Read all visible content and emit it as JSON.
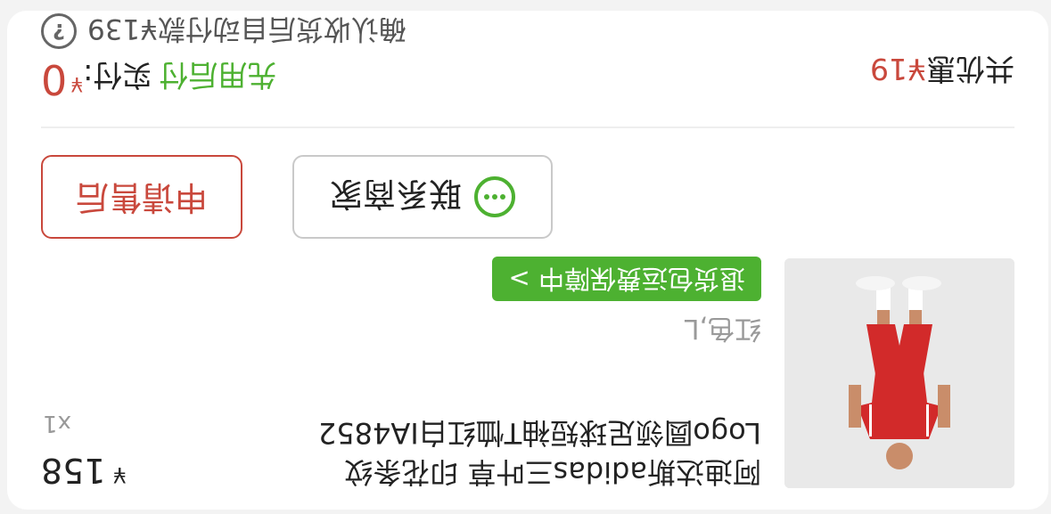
{
  "product": {
    "title": "阿迪达斯adidas三叶草 印花条纹Logo圆领足球短袖T恤红白IA4852",
    "price_symbol": "¥",
    "price": "158",
    "quantity": "x1",
    "variant": "红色,L",
    "badge": "退货包运费保障中 >",
    "image_icon": "red-white-football-kit-photo"
  },
  "actions": {
    "contact_label": "联系商家",
    "aftersale_label": "申请售后",
    "contact_icon": "chat-icon"
  },
  "summary": {
    "discount_prefix": "共优惠",
    "discount_amount": "¥19",
    "pay_later": "先用后付",
    "paid_label": "实付:",
    "paid_symbol": "¥",
    "paid_amount": "0",
    "confirm_text": "确认收货后自动付款¥139",
    "help_icon_glyph": "?"
  },
  "colors": {
    "green": "#4db131",
    "red": "#c9483c"
  }
}
